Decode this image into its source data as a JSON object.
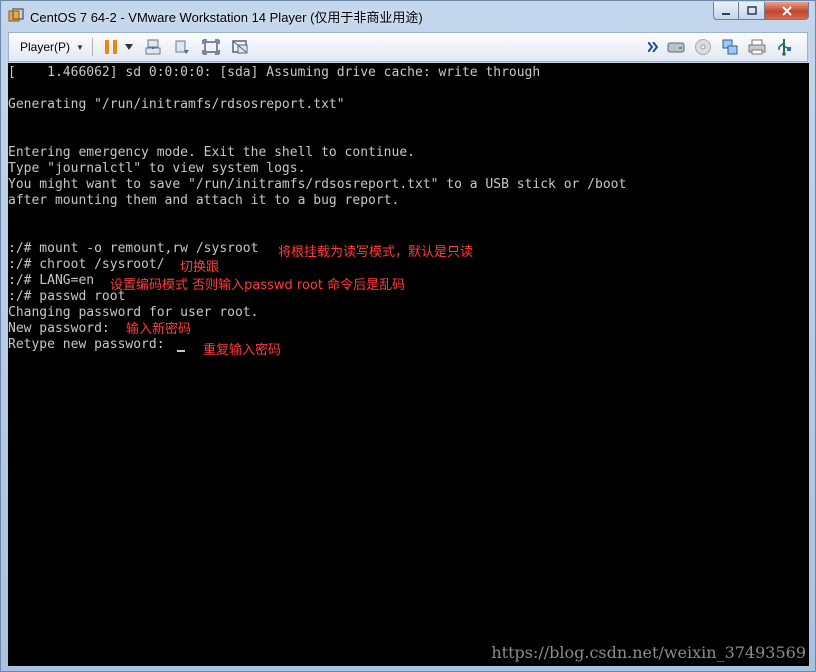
{
  "window": {
    "title": "CentOS 7 64-2 - VMware Workstation 14 Player (仅用于非商业用途)"
  },
  "toolbar": {
    "player_label": "Player(P)",
    "icons": [
      "pause-icon",
      "dropdown-icon",
      "send-keys-icon",
      "network-icon",
      "fit-window-icon",
      "unity-icon",
      "forward-icon",
      "hdd-icon",
      "cd-icon",
      "network-adapter-icon",
      "printer-icon",
      "usb-icon"
    ]
  },
  "terminal": {
    "lines": [
      "[    1.466062] sd 0:0:0:0: [sda] Assuming drive cache: write through",
      "",
      "Generating \"/run/initramfs/rdsosreport.txt\"",
      "",
      "",
      "Entering emergency mode. Exit the shell to continue.",
      "Type \"journalctl\" to view system logs.",
      "You might want to save \"/run/initramfs/rdsosreport.txt\" to a USB stick or /boot",
      "after mounting them and attach it to a bug report.",
      "",
      "",
      ":/# mount -o remount,rw /sysroot",
      ":/# chroot /sysroot/",
      ":/# LANG=en",
      ":/# passwd root",
      "Changing password for user root.",
      "New password: ",
      "Retype new password: "
    ],
    "annotations": {
      "remount": "将根挂载为读写模式，默认是只读",
      "chroot": "切换跟",
      "lang": "设置编码模式 否则输入passwd root 命令后是乱码",
      "new_password": "输入新密码",
      "retype_password": "重复输入密码"
    }
  },
  "watermark": "https://blog.csdn.net/weixin_37493569",
  "colors": {
    "annotation": "#ff3b3b",
    "terminal_text": "#c7c7c7",
    "terminal_bg": "#000000"
  }
}
